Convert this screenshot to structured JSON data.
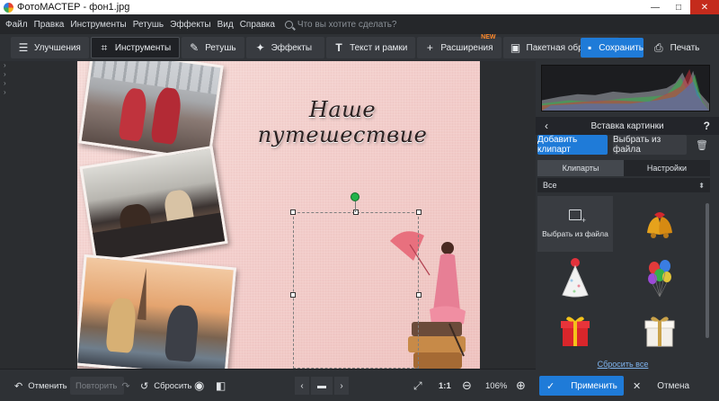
{
  "window": {
    "title": "ФотоМАСТЕР - фон1.jpg",
    "minimize_glyph": "—",
    "maximize_glyph": "□",
    "close_glyph": "✕"
  },
  "menu": {
    "items": [
      "Файл",
      "Правка",
      "Инструменты",
      "Ретушь",
      "Эффекты",
      "Вид",
      "Справка"
    ],
    "search_placeholder": "Что вы хотите сделать?"
  },
  "toolbar": {
    "tabs": [
      {
        "label": "Улучшения",
        "icon": "sliders-icon"
      },
      {
        "label": "Инструменты",
        "icon": "crop-icon"
      },
      {
        "label": "Ретушь",
        "icon": "brush-icon"
      },
      {
        "label": "Эффекты",
        "icon": "sparkle-icon"
      },
      {
        "label": "Текст и рамки",
        "icon": "text-icon"
      },
      {
        "label": "Расширения",
        "icon": "plus-icon",
        "badge": "NEW"
      },
      {
        "label": "Пакетная обработка",
        "icon": "batch-icon"
      }
    ],
    "active_tab": "Инструменты",
    "save_label": "Сохранить",
    "print_label": "Печать"
  },
  "canvas": {
    "photo_title": "Наше путешествие"
  },
  "right_panel": {
    "header_title": "Вставка картинки",
    "back_glyph": "‹",
    "help_glyph": "?",
    "add_clipart_label": "Добавить клипарт",
    "choose_file_label": "Выбрать из файла",
    "tabs": [
      "Клипарты",
      "Настройки"
    ],
    "active_tab": "Клипарты",
    "filter_value": "Все",
    "grid_file_label": "Выбрать из файла",
    "cliparts": [
      "bells-icon",
      "party-hat-icon",
      "balloons-icon",
      "gift-red-icon",
      "gift-white-icon"
    ],
    "reset_all_label": "Сбросить все",
    "apply_label": "Применить",
    "cancel_label": "Отмена"
  },
  "bottom": {
    "undo_label": "Отменить",
    "redo_label": "Повторить",
    "reset_label": "Сбросить",
    "one_to_one": "1:1",
    "zoom": "106%"
  },
  "colors": {
    "accent": "#1f7bd8",
    "new_badge": "#ff8a2b",
    "rotate_handle": "#23b34a",
    "link": "#7fb4ee"
  }
}
